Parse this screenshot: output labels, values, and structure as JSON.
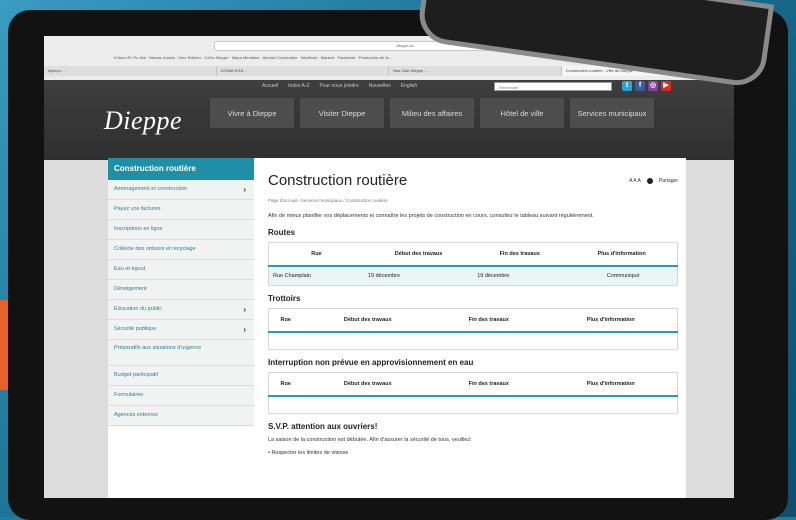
{
  "browser": {
    "url": "dieppe.ca",
    "bookmarks": "Il Nuvo Eh Pu Nat · Mazda Jurada · Zero Edición · CoDa Dieppe · Mapa Mentales · Ahmad Corporation · NeoBook · Marked · Facebook · Producción de la...",
    "tabs": [
      "Aperçu ...",
      "COMM 2015 ...",
      "Nos Club Dieppe ...",
      "Construction routière - Ville de Dieppe"
    ]
  },
  "header": {
    "utility_links": [
      "Accueil",
      "Index A-Z",
      "Pour nous joindre",
      "Nouvelles",
      "English"
    ],
    "search_placeholder": "Recherche",
    "logo_text": "Dieppe",
    "nav": [
      "Vivre à Dieppe",
      "Visiter Dieppe",
      "Milieu des affaires",
      "Hôtel de ville",
      "Services municipaux"
    ],
    "social": {
      "twitter": "t",
      "facebook": "f",
      "instagram": "◎",
      "youtube": "▶"
    }
  },
  "sidebar": {
    "title": "Construction routière",
    "items": [
      {
        "label": "Aménagement et construction",
        "arrow": "›"
      },
      {
        "label": "Payez vos factures",
        "arrow": ""
      },
      {
        "label": "Inscriptions en ligne",
        "arrow": ""
      },
      {
        "label": "Collecte des ordures et recyclage",
        "arrow": ""
      },
      {
        "label": "Eau et égout",
        "arrow": ""
      },
      {
        "label": "Déneigement",
        "arrow": ""
      },
      {
        "label": "Éducation du public",
        "arrow": "›"
      },
      {
        "label": "Sécurité publique",
        "arrow": "›"
      },
      {
        "label": "Préparatifs aux situations d'urgence",
        "arrow": ""
      },
      {
        "label": "Budget participatif",
        "arrow": ""
      },
      {
        "label": "Formulaires",
        "arrow": ""
      },
      {
        "label": "Agences externes",
        "arrow": ""
      }
    ]
  },
  "main": {
    "title": "Construction routière",
    "tools_text": "A A A",
    "share_label": "Partager",
    "breadcrumb": "Page d'accueil / Services municipaux / Construction routière",
    "intro": "Afin de mieux planifier vos déplacements et connaître les projets de construction en cours, consultez le tableau suivant régulièrement.",
    "columns": [
      "Rue",
      "Début des travaux",
      "Fin des travaux",
      "Plus d'information"
    ],
    "sections": [
      {
        "heading": "Routes",
        "rows": [
          [
            "Rue Champlain",
            "19 décembre",
            "19 décembre",
            "Communiqué"
          ]
        ]
      },
      {
        "heading": "Trottoirs",
        "rows": []
      },
      {
        "heading": "Interruption non prévue en approvisionnement en eau",
        "rows": []
      }
    ],
    "notice_heading": "S.V.P. attention aux ouvriers!",
    "notice_text": "La saison de la construction est débutée. Afin d'assurer la sécurité de tous, veuillez:",
    "bullet": "• Respecter les limites de vitesse"
  },
  "colors": {
    "accent": "#1e8fa6",
    "header_bg": "#333333",
    "page_bg": "#1c7fa0"
  }
}
